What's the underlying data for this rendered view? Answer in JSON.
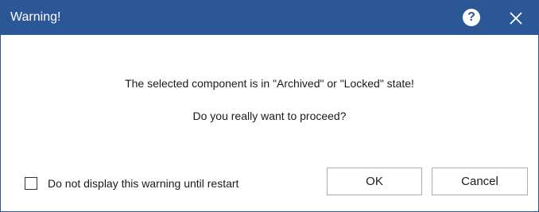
{
  "window": {
    "title": "Warning!",
    "help_label": "?",
    "close_icon": "close-icon",
    "titlebar_color": "#2b5797"
  },
  "message": {
    "line1": "The selected component is in \"Archived\" or \"Locked\" state!",
    "line2": "Do you really want to proceed?"
  },
  "checkbox": {
    "label": "Do not display this warning until restart",
    "checked": false
  },
  "buttons": {
    "ok": "OK",
    "cancel": "Cancel"
  }
}
